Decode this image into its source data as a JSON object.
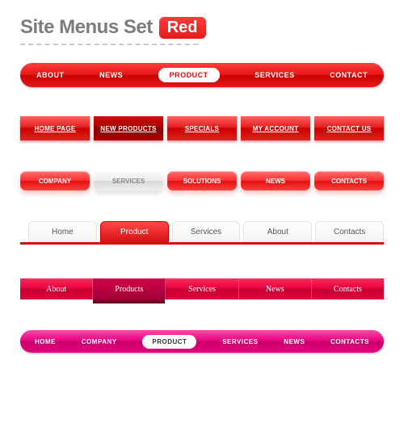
{
  "header": {
    "title": "Site Menus Set",
    "badge": "Red"
  },
  "menu1": {
    "items": [
      "ABOUT",
      "NEWS",
      "PRODUCT",
      "SERVICES",
      "CONTACT"
    ],
    "activeIndex": 2
  },
  "menu2": {
    "items": [
      "HOME PAGE",
      "NEW PRODUCTS",
      "SPECIALS",
      "MY ACCOUNT",
      "CONTACT US"
    ],
    "activeIndex": 1
  },
  "menu3": {
    "items": [
      "COMPANY",
      "SERVICES",
      "SOLUTIONS",
      "NEWS",
      "CONTACTS"
    ],
    "inactiveIndex": 1
  },
  "menu4": {
    "items": [
      "Home",
      "Product",
      "Services",
      "About",
      "Contacts"
    ],
    "activeIndex": 1
  },
  "menu5": {
    "items": [
      "About",
      "Products",
      "Services",
      "News",
      "Contacts"
    ],
    "activeIndex": 1
  },
  "menu6": {
    "items": [
      "HOME",
      "COMPANY",
      "PRODUCT",
      "SERVICES",
      "NEWS",
      "CONTACTS"
    ],
    "activeIndex": 2
  }
}
